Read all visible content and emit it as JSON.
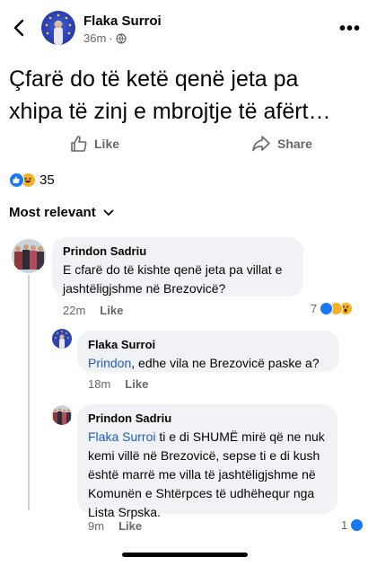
{
  "post": {
    "author": "Flaka Surroi",
    "time": "36m",
    "dot": "·",
    "privacy_icon": "globe-icon",
    "text_line1": "Çfarë do të ketë qenë jeta pa",
    "text_line2": "xhipa të zinj e mbrojtje të afërt…",
    "reaction_count": "35"
  },
  "actions": {
    "like_label": "Like",
    "share_label": "Share"
  },
  "sort": {
    "label": "Most relevant"
  },
  "comments": [
    {
      "name": "Prindon Sadriu",
      "text": "E cfarë do të kishte qenë jeta pa villat e jashtëligjshme në Brezovicë?",
      "time": "22m",
      "like_label": "Like",
      "reaction_count": "7"
    },
    {
      "name": "Flaka Surroi",
      "mention": "Prindon",
      "text": ", edhe vila ne Brezovicë paske a?",
      "time": "18m",
      "like_label": "Like"
    },
    {
      "name": "Prindon Sadriu",
      "mention": "Flaka Surroi",
      "text": " ti e di SHUMË mirë që ne nuk kemi villë në Brezovicë, sepse ti e di kush është marrë me villa të jashtëligjshme në Komunën e Shtërpces të udhëhequr nga Lista Srpska.",
      "time": "9m",
      "like_label": "Like",
      "reaction_count": "1"
    }
  ],
  "colors": {
    "accent": "#1877f2",
    "bubble": "#f0f2f5",
    "muted": "#65676b",
    "mention": "#1b5cc7"
  }
}
